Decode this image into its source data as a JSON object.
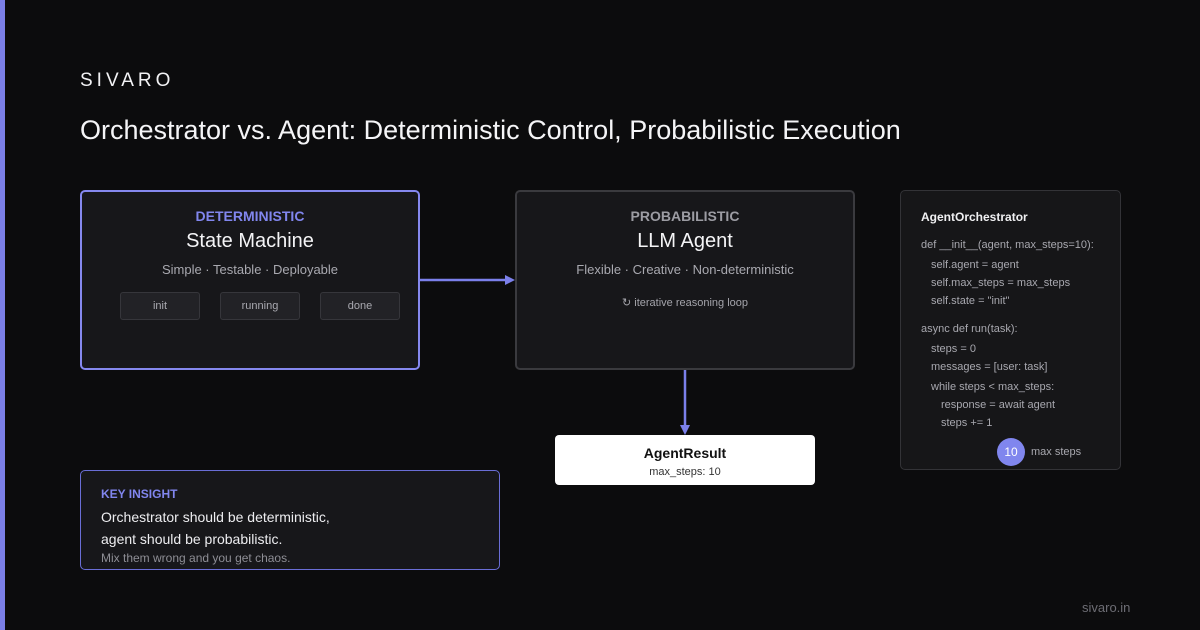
{
  "brand": "SIVARO",
  "title": "Orchestrator vs. Agent: Deterministic Control, Probabilistic Execution",
  "deterministic": {
    "kind": "DETERMINISTIC",
    "title": "State Machine",
    "subtitle": "Simple · Testable · Deployable",
    "states": [
      "init",
      "running",
      "done"
    ]
  },
  "probabilistic": {
    "kind": "PROBABILISTIC",
    "title": "LLM Agent",
    "subtitle": "Flexible · Creative · Non-deterministic",
    "loop_icon": "↻",
    "loop_label": "iterative reasoning loop"
  },
  "result": {
    "title": "AgentResult",
    "subtitle": "max_steps: 10"
  },
  "code": {
    "title": "AgentOrchestrator",
    "lines": [
      "def __init__(agent, max_steps=10):",
      "self.agent = agent",
      "self.max_steps = max_steps",
      "self.state = \"init\"",
      "async def run(task):",
      "steps = 0",
      "messages = [user: task]",
      "while steps < max_steps:",
      "response = await agent",
      "steps += 1"
    ],
    "badge_value": "10",
    "badge_label": "max steps"
  },
  "insight": {
    "heading": "KEY INSIGHT",
    "line1": "Orchestrator should be deterministic,",
    "line2": "agent should be probabilistic.",
    "footnote": "Mix them wrong and you get chaos."
  },
  "footer": "sivaro.in",
  "colors": {
    "accent": "#8186ee",
    "background": "#0c0c0d",
    "card": "#17171a"
  }
}
